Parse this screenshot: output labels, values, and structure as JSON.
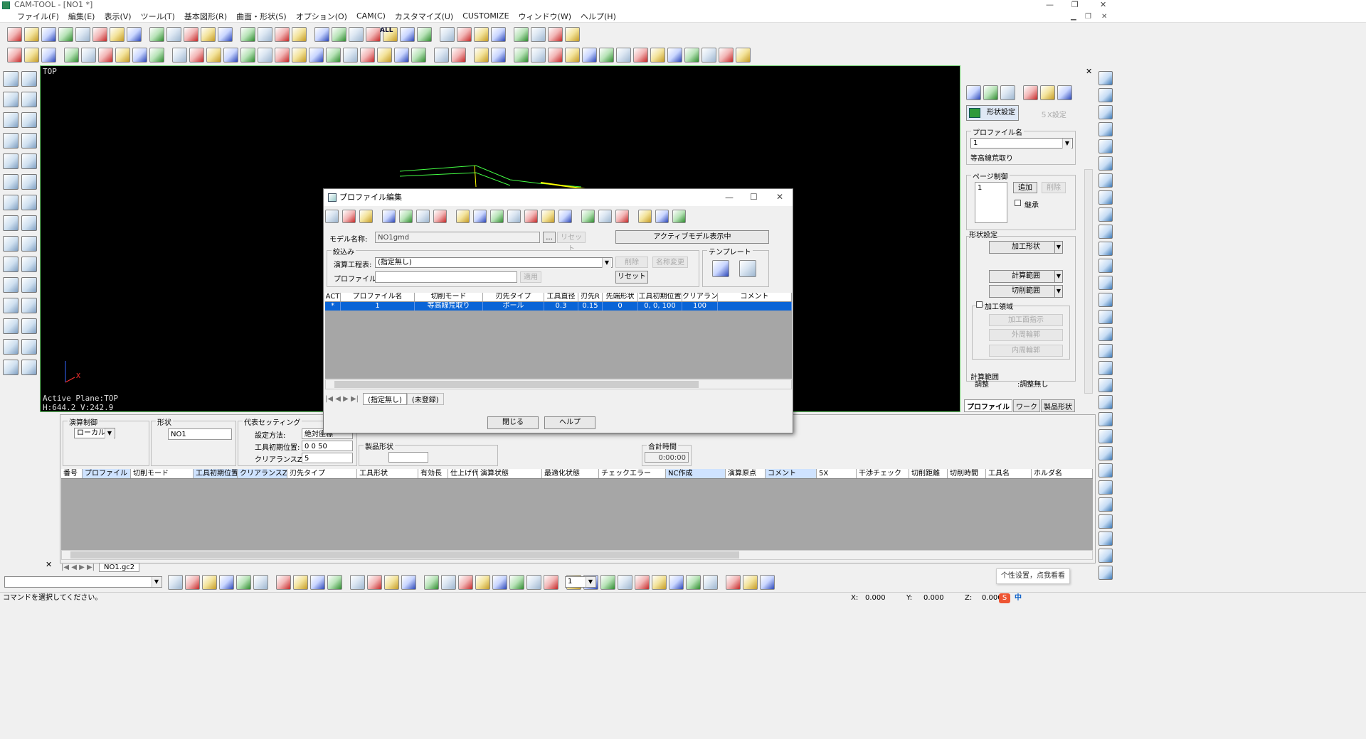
{
  "window": {
    "title": "CAM-TOOL - [NO1 *]"
  },
  "menu": [
    "ファイル(F)",
    "編集(E)",
    "表示(V)",
    "ツール(T)",
    "基本図形(R)",
    "曲面・形状(S)",
    "オプション(O)",
    "CAM(C)",
    "カスタマイズ(U)",
    "CUSTOMIZE",
    "ウィンドウ(W)",
    "ヘルプ(H)"
  ],
  "toolbar_labels": {
    "all": "ALL"
  },
  "viewport": {
    "view_name": "TOP",
    "active_plane": "Active Plane:TOP",
    "coords": "H:644.2 V:242.9"
  },
  "right_panel": {
    "tab_shape": "形状設定",
    "tab_5x": "５X設定",
    "profile_name_label": "プロファイル名",
    "profile_value": "1",
    "profile_mode": "等高線荒取り",
    "page_control_label": "ページ制御",
    "page_item": "1",
    "add_btn": "追加",
    "delete_btn": "削除",
    "inherit_label": "継承",
    "shape_setting_label": "形状設定",
    "machining_shape_btn": "加工形状",
    "calc_range_btn": "計算範囲",
    "cut_range_btn": "切削範囲",
    "machining_area_label": "加工領域",
    "area_indicate_btn": "加工面指示",
    "outer_btn": "外周輪郭",
    "inner_btn": "内周輪郭",
    "calc_range_info_label": "計算範囲",
    "calc_range_info_sub": "調整",
    "calc_range_info_value": ":調整無し",
    "bottom_tabs": [
      "プロファイル",
      "ワーク",
      "製品形状"
    ]
  },
  "dialog": {
    "title": "プロファイル編集",
    "model_name_label": "モデル名称:",
    "model_name_value": "NO1gmd",
    "browse_btn": "...",
    "reset_btn_disabled": "リセット",
    "active_model_btn": "アクティブモデル表示中",
    "filter_label": "絞込み",
    "process_label": "演算工程表:",
    "process_value": "(指定無し)",
    "delete_btn": "削除",
    "rename_btn": "名称変更",
    "profile_label": "プロファイル:",
    "apply_btn": "適用",
    "reset_btn": "リセット",
    "template_label": "テンプレート",
    "table": {
      "headers": [
        "ACT",
        "プロファイル名",
        "切削モード",
        "刃先タイプ",
        "工具直径",
        "刃先R",
        "先端形状",
        "工具初期位置",
        "クリアランスZ",
        "コメント"
      ],
      "rows": [
        [
          "*",
          "1",
          "等高線荒取り",
          "ボール",
          "0.3",
          "0.15",
          "0",
          "0, 0, 100",
          "100",
          ""
        ]
      ]
    },
    "tabs": [
      "(指定無し)",
      "(未登録)"
    ],
    "close_btn": "閉じる",
    "help_btn": "ヘルプ"
  },
  "lower_panel": {
    "calc_control_label": "演算制御",
    "coord_value": "ローカル",
    "shape_label": "形状",
    "shape_value": "NO1",
    "rep_setting_label": "代表セッティング",
    "setting_method_label": "設定方法:",
    "setting_method_value": "絶対座標",
    "tool_init_label": "工具初期位置:",
    "tool_init_value": "0 0 50",
    "clearance_label": "クリアランスZ:",
    "clearance_value": "5",
    "product_shape_label": "製品形状",
    "total_time_label": "合計時間",
    "total_time_value": "0:00:00",
    "grid_headers": [
      "番号",
      "プロファイル",
      "切削モード",
      "工具初期位置",
      "クリアランスZ値",
      "刃先タイプ",
      "工具形状",
      "有効長",
      "仕上げ代",
      "演算状態",
      "最適化状態",
      "チェックエラー",
      "NC作成",
      "演算原点",
      "コメント",
      "5X",
      "干渉チェック",
      "切削距離",
      "切削時間",
      "工具名",
      "ホルダ名"
    ],
    "tab": "NO1.gc2"
  },
  "bottom_toolbar": {
    "layer_value": "1"
  },
  "status": {
    "message": "コマンドを選択してください。",
    "x_label": "X:",
    "x_value": "0.000",
    "y_label": "Y:",
    "y_value": "0.000",
    "z_label": "Z:",
    "z_value": "0.000",
    "ime_tip": "个性设置，点我看看",
    "ime_char": "中"
  }
}
